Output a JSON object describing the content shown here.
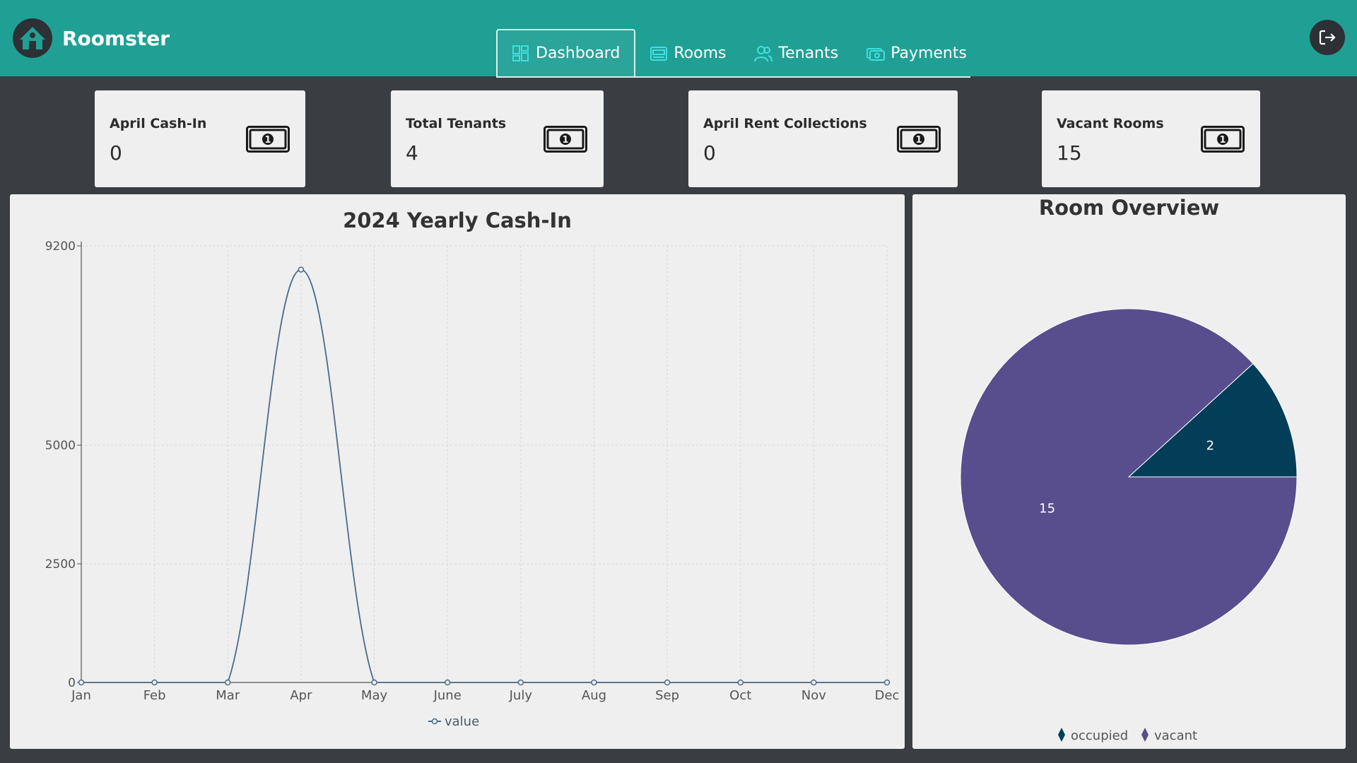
{
  "app": {
    "name": "Roomster"
  },
  "nav": {
    "items": [
      {
        "label": "Dashboard",
        "active": true
      },
      {
        "label": "Rooms",
        "active": false
      },
      {
        "label": "Tenants",
        "active": false
      },
      {
        "label": "Payments",
        "active": false
      }
    ]
  },
  "stats": [
    {
      "label": "April Cash-In",
      "value": "0",
      "icon": "money-icon"
    },
    {
      "label": "Total Tenants",
      "value": "4",
      "icon": "money-icon"
    },
    {
      "label": "April Rent Collections",
      "value": "0",
      "icon": "money-icon"
    },
    {
      "label": "Vacant Rooms",
      "value": "15",
      "icon": "money-icon"
    }
  ],
  "colors": {
    "header": "#20a095",
    "background": "#3a3d42",
    "line": "#4a6b8a",
    "pie_vacant": "#584e8e",
    "pie_occupied": "#023e58"
  },
  "chart_data": [
    {
      "type": "line",
      "title": "2024 Yearly Cash-In",
      "x": [
        "Jan",
        "Feb",
        "Mar",
        "Apr",
        "May",
        "June",
        "July",
        "Aug",
        "Sep",
        "Oct",
        "Nov",
        "Dec"
      ],
      "series": [
        {
          "name": "value",
          "values": [
            0,
            0,
            0,
            8700,
            0,
            0,
            0,
            0,
            0,
            0,
            0,
            0
          ]
        }
      ],
      "yticks": [
        "0",
        "2500",
        "5000",
        "9200"
      ],
      "ylim": [
        0,
        9200
      ],
      "grid": true,
      "legend": "bottom-center",
      "smooth": true
    },
    {
      "type": "pie",
      "title": "Room Overview",
      "slices": [
        {
          "name": "occupied",
          "value": 2,
          "label": "2"
        },
        {
          "name": "vacant",
          "value": 15,
          "label": "15"
        }
      ],
      "legend": "bottom-center"
    }
  ]
}
